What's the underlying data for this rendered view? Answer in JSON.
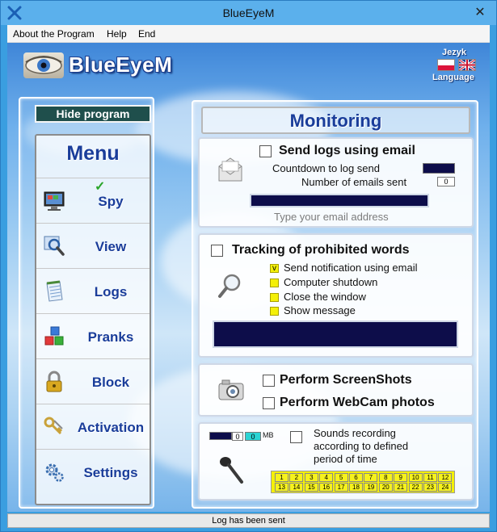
{
  "window": {
    "title": "BlueEyeM",
    "close_glyph": "✕"
  },
  "menubar": {
    "items": [
      "About the Program",
      "Help",
      "End"
    ]
  },
  "header": {
    "logo_text": "BlueEyeM",
    "language_label_pl": "Jezyk",
    "language_label_en": "Language"
  },
  "sidebar": {
    "hide_button": "Hide program",
    "menu_title": "Menu",
    "items": [
      {
        "label": "Spy",
        "icon": "monitor-icon",
        "checked": true
      },
      {
        "label": "View",
        "icon": "magnifier-icon"
      },
      {
        "label": "Logs",
        "icon": "notepad-icon"
      },
      {
        "label": "Pranks",
        "icon": "cubes-icon"
      },
      {
        "label": "Block",
        "icon": "padlock-icon"
      },
      {
        "label": "Activation",
        "icon": "keys-icon"
      },
      {
        "label": "Settings",
        "icon": "gears-icon"
      }
    ],
    "check_glyph": "✓"
  },
  "monitoring": {
    "title": "Monitoring",
    "email_section": {
      "send_logs_label": "Send logs using email",
      "send_logs_checked": false,
      "countdown_label": "Countdown to log send",
      "emails_sent_label": "Number of emails sent",
      "emails_sent_value": "0",
      "email_placeholder": "Type your email address"
    },
    "words_section": {
      "tracking_label": "Tracking of prohibited words",
      "tracking_checked": false,
      "options": [
        {
          "label": "Send notification using email",
          "checked": true
        },
        {
          "label": "Computer shutdown",
          "checked": false
        },
        {
          "label": "Close the window",
          "checked": false
        },
        {
          "label": "Show message",
          "checked": false
        }
      ]
    },
    "capture_section": {
      "screenshots_label": "Perform ScreenShots",
      "webcam_label": "Perform WebCam photos"
    },
    "sound_section": {
      "size_value_1": "0",
      "size_value_2": "0",
      "size_unit": "MB",
      "sounds_label_line1": "Sounds recording",
      "sounds_label_line2": "according to defined",
      "sounds_label_line3": "period of time",
      "hours_row1": [
        "1",
        "2",
        "3",
        "4",
        "5",
        "6",
        "7",
        "8",
        "9",
        "10",
        "11",
        "12"
      ],
      "hours_row2": [
        "13",
        "14",
        "15",
        "16",
        "17",
        "18",
        "19",
        "20",
        "21",
        "22",
        "23",
        "24"
      ]
    }
  },
  "statusbar": {
    "text": "Log has been sent"
  },
  "colors": {
    "accent_text": "#1a3d9a",
    "navy_field": "#0d0d4a",
    "yellow_check": "#f4f008",
    "hide_button_bg": "#1f4f4c"
  }
}
